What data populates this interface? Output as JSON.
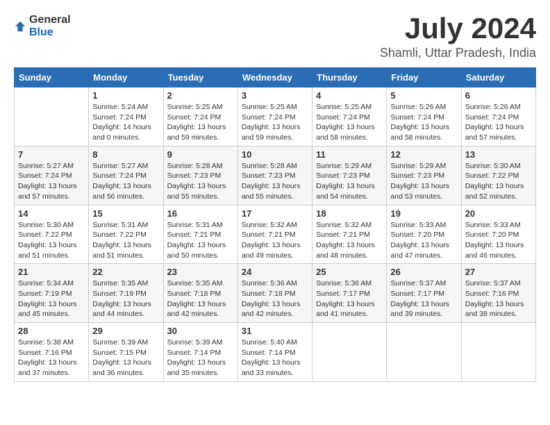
{
  "logo": {
    "general": "General",
    "blue": "Blue"
  },
  "title": {
    "month": "July 2024",
    "location": "Shamli, Uttar Pradesh, India"
  },
  "calendar": {
    "headers": [
      "Sunday",
      "Monday",
      "Tuesday",
      "Wednesday",
      "Thursday",
      "Friday",
      "Saturday"
    ],
    "weeks": [
      [
        {
          "day": "",
          "info": ""
        },
        {
          "day": "1",
          "info": "Sunrise: 5:24 AM\nSunset: 7:24 PM\nDaylight: 14 hours\nand 0 minutes."
        },
        {
          "day": "2",
          "info": "Sunrise: 5:25 AM\nSunset: 7:24 PM\nDaylight: 13 hours\nand 59 minutes."
        },
        {
          "day": "3",
          "info": "Sunrise: 5:25 AM\nSunset: 7:24 PM\nDaylight: 13 hours\nand 59 minutes."
        },
        {
          "day": "4",
          "info": "Sunrise: 5:25 AM\nSunset: 7:24 PM\nDaylight: 13 hours\nand 58 minutes."
        },
        {
          "day": "5",
          "info": "Sunrise: 5:26 AM\nSunset: 7:24 PM\nDaylight: 13 hours\nand 58 minutes."
        },
        {
          "day": "6",
          "info": "Sunrise: 5:26 AM\nSunset: 7:24 PM\nDaylight: 13 hours\nand 57 minutes."
        }
      ],
      [
        {
          "day": "7",
          "info": "Sunrise: 5:27 AM\nSunset: 7:24 PM\nDaylight: 13 hours\nand 57 minutes."
        },
        {
          "day": "8",
          "info": "Sunrise: 5:27 AM\nSunset: 7:24 PM\nDaylight: 13 hours\nand 56 minutes."
        },
        {
          "day": "9",
          "info": "Sunrise: 5:28 AM\nSunset: 7:23 PM\nDaylight: 13 hours\nand 55 minutes."
        },
        {
          "day": "10",
          "info": "Sunrise: 5:28 AM\nSunset: 7:23 PM\nDaylight: 13 hours\nand 55 minutes."
        },
        {
          "day": "11",
          "info": "Sunrise: 5:29 AM\nSunset: 7:23 PM\nDaylight: 13 hours\nand 54 minutes."
        },
        {
          "day": "12",
          "info": "Sunrise: 5:29 AM\nSunset: 7:23 PM\nDaylight: 13 hours\nand 53 minutes."
        },
        {
          "day": "13",
          "info": "Sunrise: 5:30 AM\nSunset: 7:22 PM\nDaylight: 13 hours\nand 52 minutes."
        }
      ],
      [
        {
          "day": "14",
          "info": "Sunrise: 5:30 AM\nSunset: 7:22 PM\nDaylight: 13 hours\nand 51 minutes."
        },
        {
          "day": "15",
          "info": "Sunrise: 5:31 AM\nSunset: 7:22 PM\nDaylight: 13 hours\nand 51 minutes."
        },
        {
          "day": "16",
          "info": "Sunrise: 5:31 AM\nSunset: 7:21 PM\nDaylight: 13 hours\nand 50 minutes."
        },
        {
          "day": "17",
          "info": "Sunrise: 5:32 AM\nSunset: 7:21 PM\nDaylight: 13 hours\nand 49 minutes."
        },
        {
          "day": "18",
          "info": "Sunrise: 5:32 AM\nSunset: 7:21 PM\nDaylight: 13 hours\nand 48 minutes."
        },
        {
          "day": "19",
          "info": "Sunrise: 5:33 AM\nSunset: 7:20 PM\nDaylight: 13 hours\nand 47 minutes."
        },
        {
          "day": "20",
          "info": "Sunrise: 5:33 AM\nSunset: 7:20 PM\nDaylight: 13 hours\nand 46 minutes."
        }
      ],
      [
        {
          "day": "21",
          "info": "Sunrise: 5:34 AM\nSunset: 7:19 PM\nDaylight: 13 hours\nand 45 minutes."
        },
        {
          "day": "22",
          "info": "Sunrise: 5:35 AM\nSunset: 7:19 PM\nDaylight: 13 hours\nand 44 minutes."
        },
        {
          "day": "23",
          "info": "Sunrise: 5:35 AM\nSunset: 7:18 PM\nDaylight: 13 hours\nand 42 minutes."
        },
        {
          "day": "24",
          "info": "Sunrise: 5:36 AM\nSunset: 7:18 PM\nDaylight: 13 hours\nand 42 minutes."
        },
        {
          "day": "25",
          "info": "Sunrise: 5:36 AM\nSunset: 7:17 PM\nDaylight: 13 hours\nand 41 minutes."
        },
        {
          "day": "26",
          "info": "Sunrise: 5:37 AM\nSunset: 7:17 PM\nDaylight: 13 hours\nand 39 minutes."
        },
        {
          "day": "27",
          "info": "Sunrise: 5:37 AM\nSunset: 7:16 PM\nDaylight: 13 hours\nand 38 minutes."
        }
      ],
      [
        {
          "day": "28",
          "info": "Sunrise: 5:38 AM\nSunset: 7:16 PM\nDaylight: 13 hours\nand 37 minutes."
        },
        {
          "day": "29",
          "info": "Sunrise: 5:39 AM\nSunset: 7:15 PM\nDaylight: 13 hours\nand 36 minutes."
        },
        {
          "day": "30",
          "info": "Sunrise: 5:39 AM\nSunset: 7:14 PM\nDaylight: 13 hours\nand 35 minutes."
        },
        {
          "day": "31",
          "info": "Sunrise: 5:40 AM\nSunset: 7:14 PM\nDaylight: 13 hours\nand 33 minutes."
        },
        {
          "day": "",
          "info": ""
        },
        {
          "day": "",
          "info": ""
        },
        {
          "day": "",
          "info": ""
        }
      ]
    ]
  }
}
